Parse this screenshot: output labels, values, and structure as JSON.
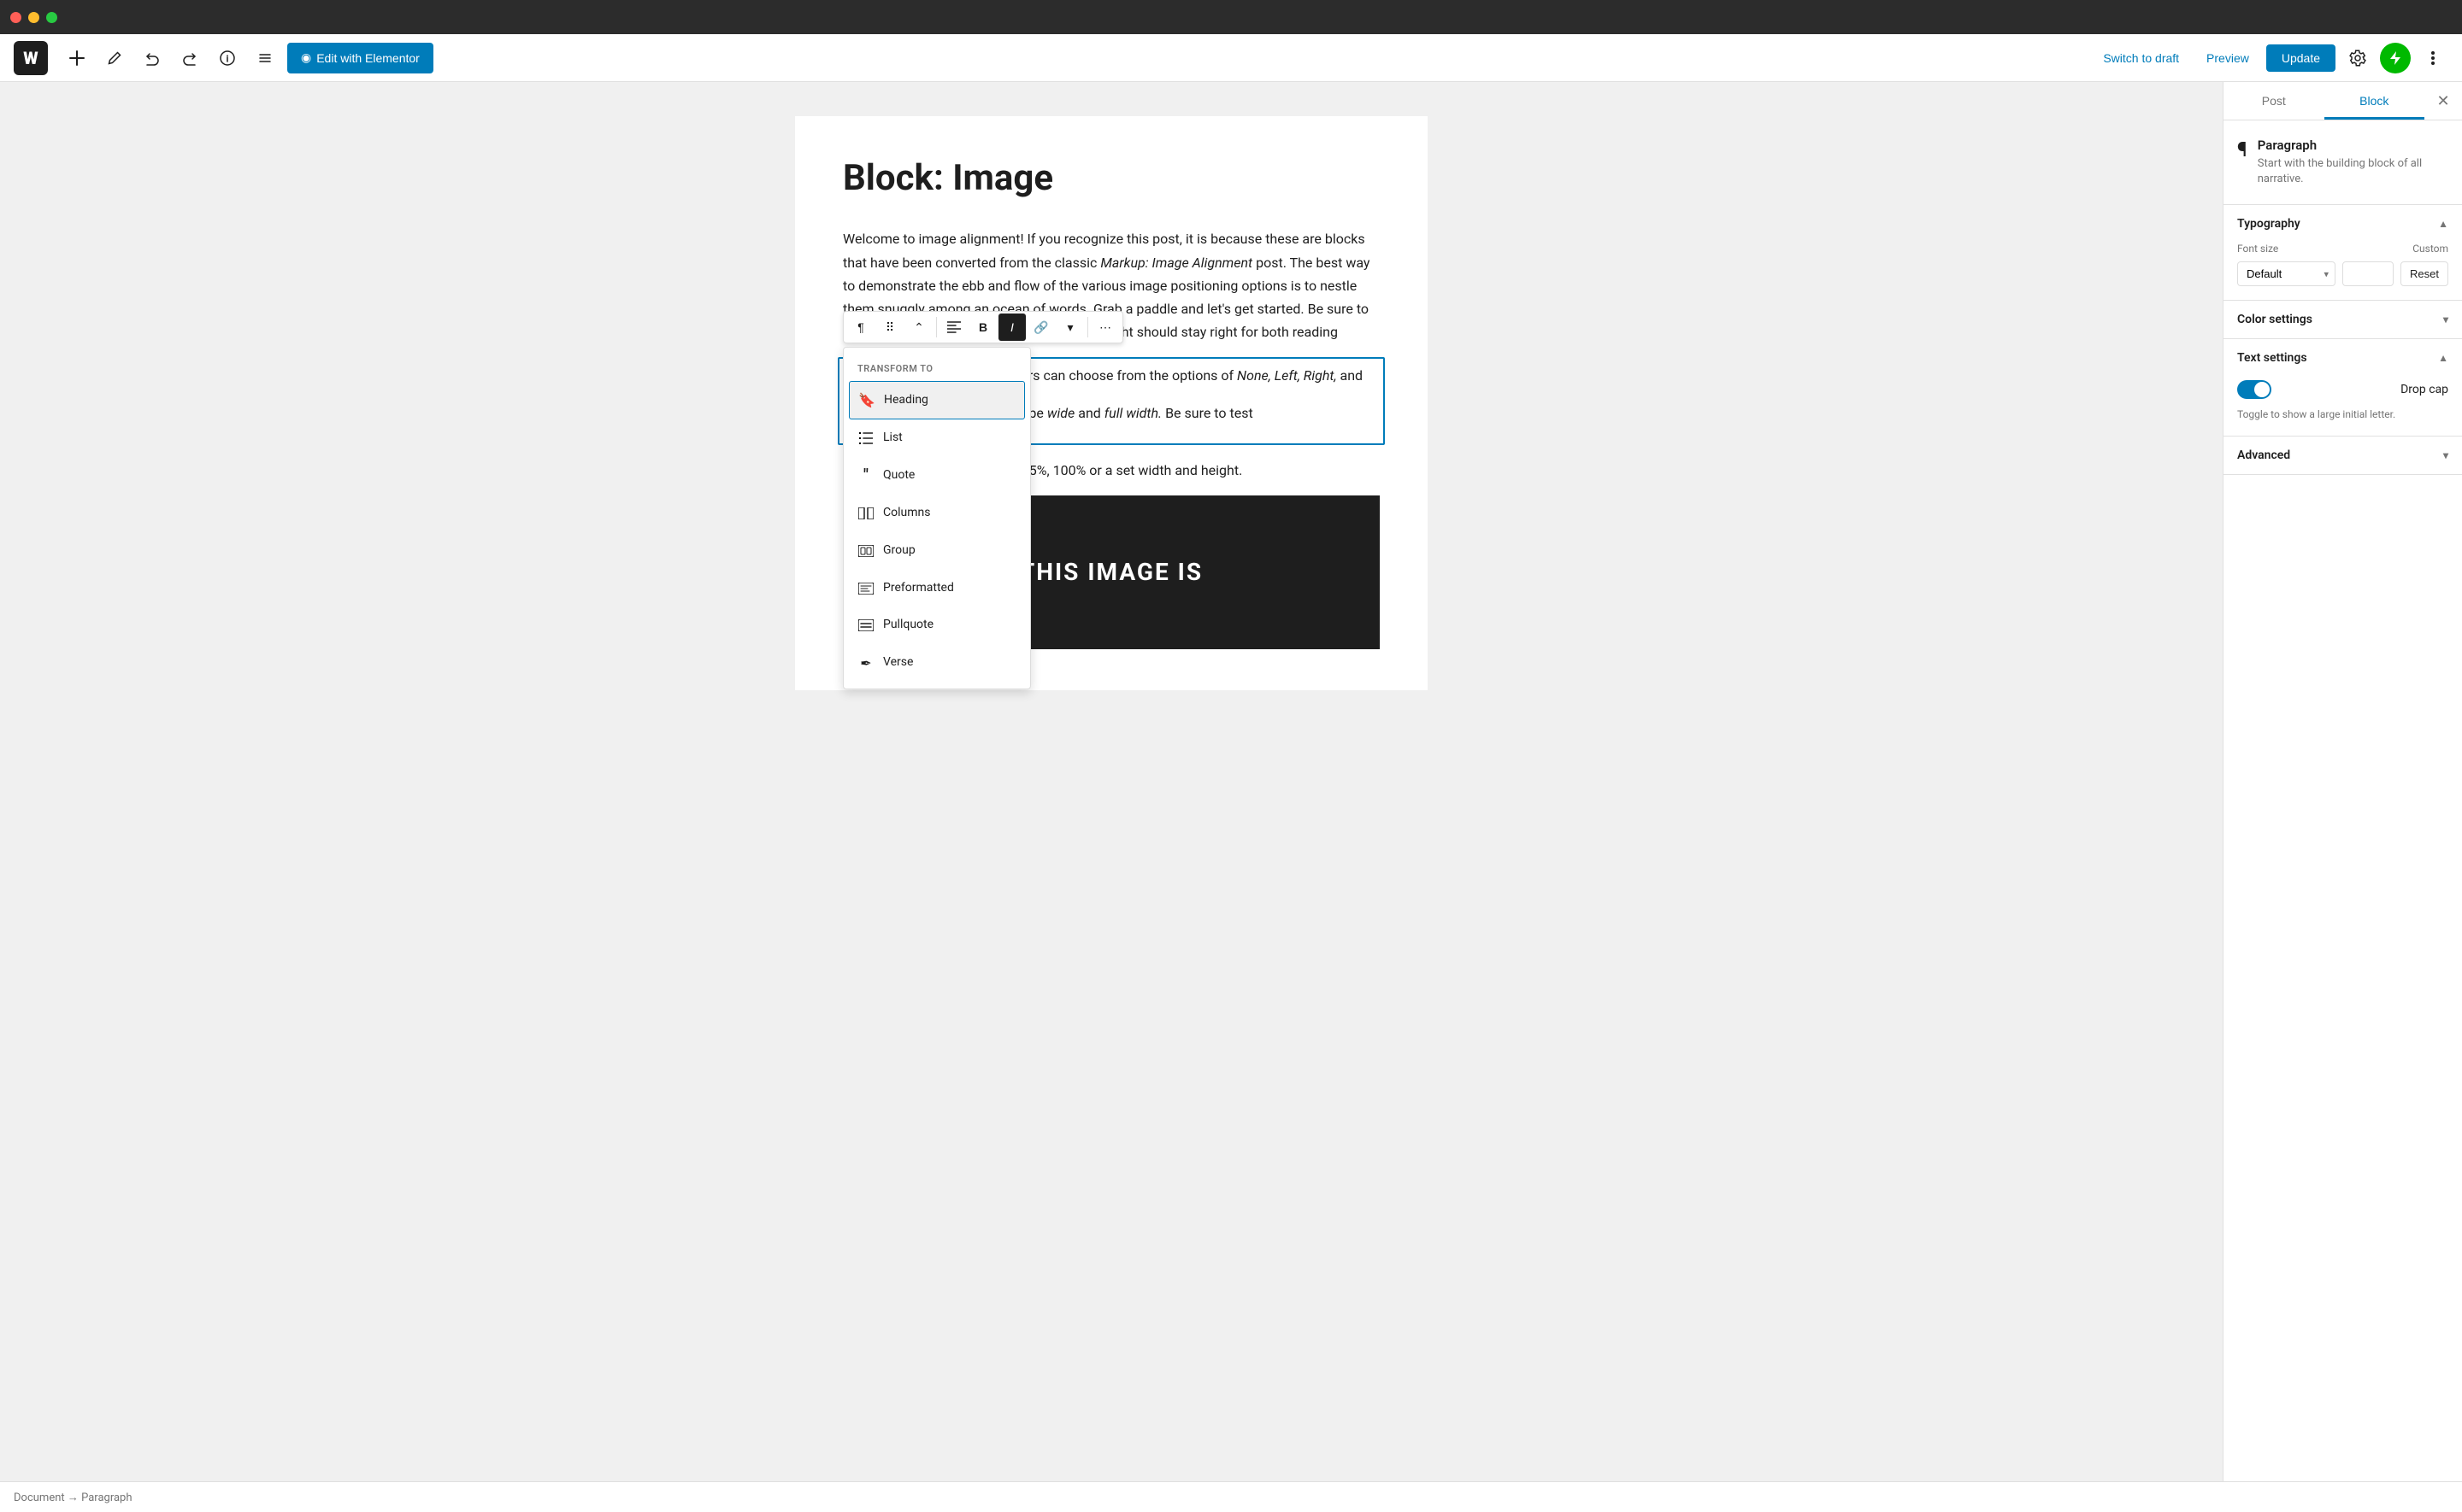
{
  "titleBar": {
    "dots": [
      "red",
      "yellow",
      "green"
    ]
  },
  "topToolbar": {
    "addLabel": "+",
    "editLabel": "Edit with Elementor",
    "switchToDraft": "Switch to draft",
    "preview": "Preview",
    "update": "Update"
  },
  "editor": {
    "postTitle": "Block: Image",
    "paragraph1": "Welcome to image alignment! If you recognize this post, it is because these are blocks that have been converted from the classic Markup: Image Alignment post. The best way to demonstrate the ebb and flow of the various image positioning options is to nestle them snuggly among an ocean of words. Grab a paddle and let's get started. Be sure to try it in RTL mode. Left should stay left and right should stay right for both reading",
    "paragraph2Selected": "It is important to note that users can choose from the options of None, Left, Right, and",
    "paragraph2b": "or align wide, images can also be wide and full width. Be sure to test",
    "paragraph3": "Image dimensions 25%, 50%, 75%, 100% or a set width and height.",
    "darkImageText": "THIS IMAGE IS",
    "transformLabel": "TRANSFORM TO",
    "transformItems": [
      {
        "id": "heading",
        "label": "Heading",
        "icon": "bookmark",
        "selected": true
      },
      {
        "id": "list",
        "label": "List",
        "icon": "list"
      },
      {
        "id": "quote",
        "label": "Quote",
        "icon": "quote"
      },
      {
        "id": "columns",
        "label": "Columns",
        "icon": "columns"
      },
      {
        "id": "group",
        "label": "Group",
        "icon": "group"
      },
      {
        "id": "preformatted",
        "label": "Preformatted",
        "icon": "preformatted"
      },
      {
        "id": "pullquote",
        "label": "Pullquote",
        "icon": "pullquote"
      },
      {
        "id": "verse",
        "label": "Verse",
        "icon": "verse"
      }
    ]
  },
  "sidebar": {
    "tabs": [
      {
        "id": "post",
        "label": "Post"
      },
      {
        "id": "block",
        "label": "Block"
      }
    ],
    "activeTab": "block",
    "blockInfo": {
      "name": "Paragraph",
      "description": "Start with the building block of all narrative."
    },
    "sections": {
      "typography": {
        "label": "Typography",
        "expanded": true,
        "fontSizeLabel": "Font size",
        "fontSizeCustomLabel": "Custom",
        "fontSizeDefault": "Default",
        "resetLabel": "Reset"
      },
      "colorSettings": {
        "label": "Color settings",
        "expanded": false
      },
      "textSettings": {
        "label": "Text settings",
        "expanded": true,
        "dropCapLabel": "Drop cap",
        "dropCapDescription": "Toggle to show a large initial letter.",
        "dropCapEnabled": true
      },
      "advanced": {
        "label": "Advanced",
        "expanded": false
      }
    }
  },
  "statusBar": {
    "breadcrumb": "Document → Paragraph"
  }
}
